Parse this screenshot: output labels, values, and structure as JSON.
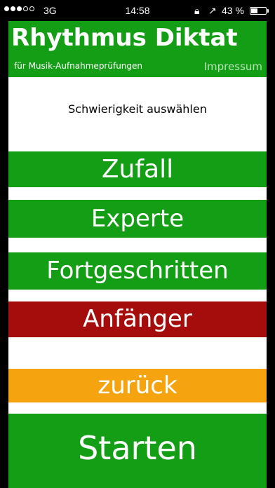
{
  "status_bar": {
    "signal_dots_filled": 3,
    "signal_dots_total": 5,
    "carrier": "3G",
    "time": "14:58",
    "rotation_lock_icon": "rotation-lock-icon",
    "location_icon": "location-arrow-icon",
    "battery_percent": "43 %",
    "battery_level": 0.43
  },
  "header": {
    "title": "Rhythmus Diktat",
    "subtitle": "für Musik-Aufnahmeprüfungen",
    "impressum": "Impressum"
  },
  "prompt": "Schwierigkeit auswählen",
  "buttons": {
    "zufall": "Zufall",
    "experte": "Experte",
    "fortgeschritten": "Fortgeschritten",
    "anfaenger": "Anfänger",
    "zurueck": "zurück",
    "starten": "Starten"
  },
  "colors": {
    "green": "#149e15",
    "selected_red": "#a50d0d",
    "back_orange": "#f5a30f"
  }
}
